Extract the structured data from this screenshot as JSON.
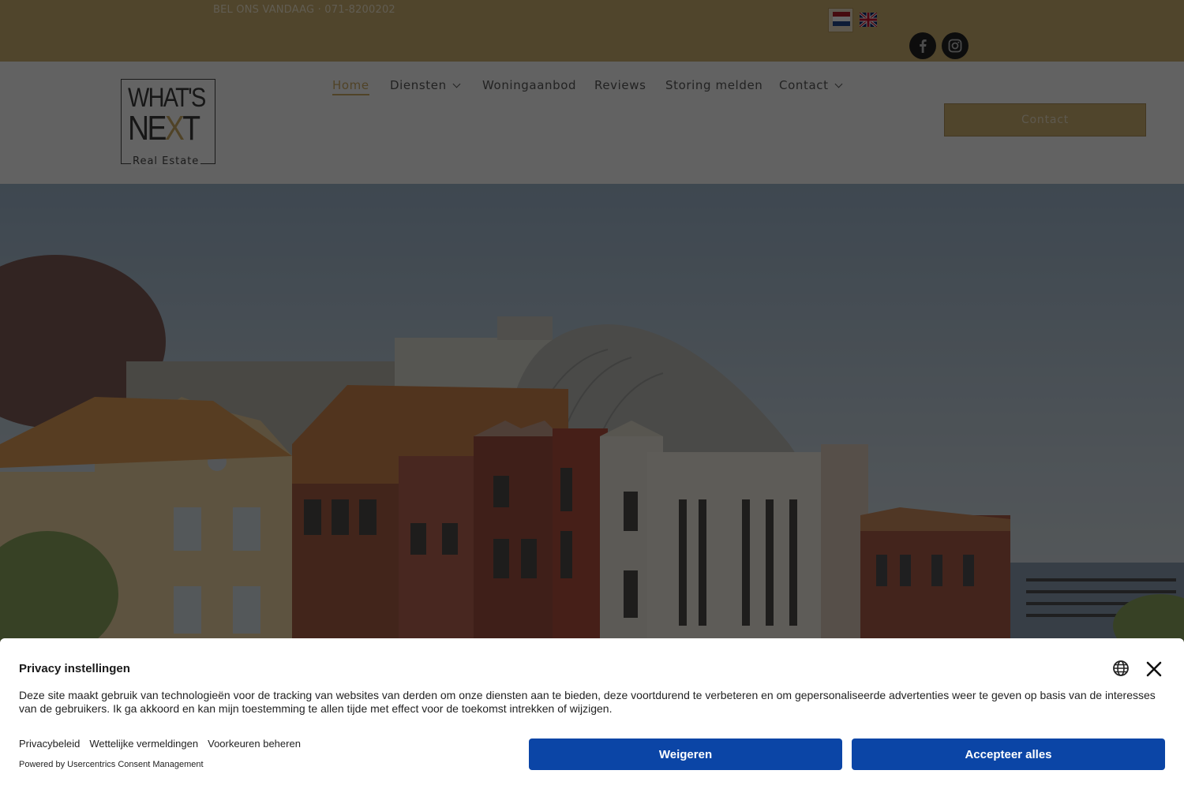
{
  "topbar": {
    "phone_text": "BEL ONS VANDAAG · 071-8200202",
    "languages": [
      "nl-flag-icon",
      "uk-flag-icon"
    ],
    "social_icons": [
      "facebook-icon",
      "instagram-icon"
    ]
  },
  "header": {
    "logo": {
      "line1": "WHAT'S",
      "line2_a": "NE",
      "line2_x": "X",
      "line2_b": "T",
      "line3": "Real Estate"
    },
    "nav": {
      "home": "Home",
      "diensten": "Diensten",
      "woningaanbod": "Woningaanbod",
      "reviews": "Reviews",
      "storing": "Storing melden",
      "contact": "Contact"
    },
    "contact_button": "Contact"
  },
  "consent": {
    "title": "Privacy instellingen",
    "text": "Deze site maakt gebruik van technologieën voor de tracking van websites van derden om onze diensten aan te bieden, deze voortdurend te verbeteren en om gepersonaliseerde advertenties weer te geven op basis van de interesses van de gebruikers. Ik ga akkoord en kan mijn toestemming te allen tijde met effect voor de toekomst intrekken of wijzigen.",
    "links": {
      "privacy": "Privacybeleid",
      "legal": "Wettelijke vermeldingen",
      "preferences": "Voorkeuren beheren"
    },
    "powered": "Powered by Usercentrics Consent Management",
    "deny_label": "Weigeren",
    "accept_label": "Accepteer alles"
  },
  "colors": {
    "gold": "#c9ad6e",
    "accent": "#c9a761",
    "button_blue": "#0b45a6"
  }
}
